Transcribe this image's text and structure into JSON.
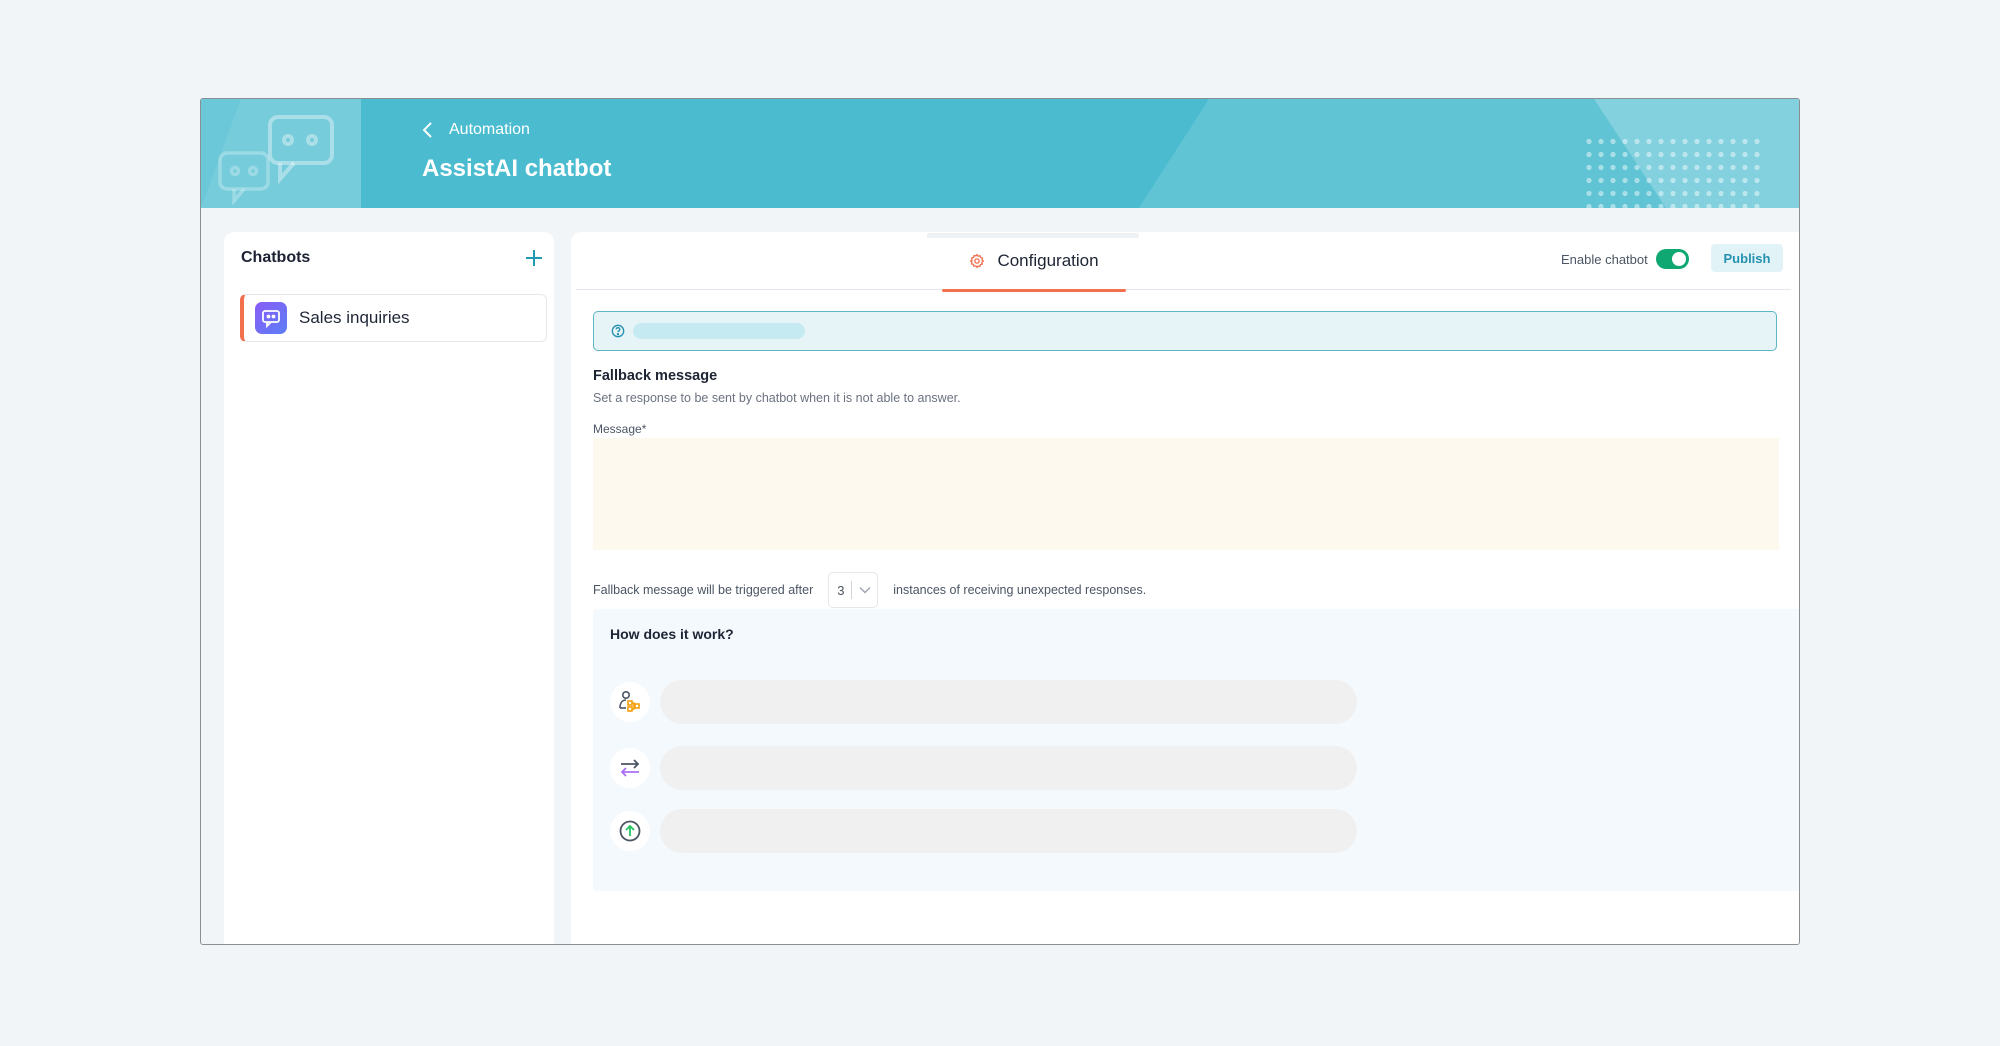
{
  "header": {
    "breadcrumb": "Automation",
    "title": "AssistAI chatbot"
  },
  "sidebar": {
    "title": "Chatbots",
    "add_icon": "plus-icon",
    "items": [
      {
        "label": "Sales inquiries",
        "icon": "chatbot-icon",
        "selected": true
      }
    ]
  },
  "main": {
    "tabs": [
      {
        "label": "Configuration",
        "icon": "gear-icon",
        "active": true
      }
    ],
    "enable_label": "Enable chatbot",
    "enabled": true,
    "publish_label": "Publish",
    "fallback": {
      "title": "Fallback message",
      "description": "Set a response to be sent by chatbot when it is not able to answer.",
      "message_label": "Message*",
      "message_value": "",
      "trigger_prefix": "Fallback message will be triggered after",
      "trigger_count": "3",
      "trigger_suffix": "instances of receiving unexpected responses."
    },
    "how": {
      "title": "How does it work?",
      "steps": [
        {
          "icon": "user-flow-icon"
        },
        {
          "icon": "swap-arrows-icon"
        },
        {
          "icon": "upload-circle-icon"
        }
      ]
    }
  },
  "colors": {
    "banner": "#4bbcd0",
    "accent": "#f2704e",
    "toggle_on": "#10a872",
    "publish_text": "#2591b0"
  }
}
